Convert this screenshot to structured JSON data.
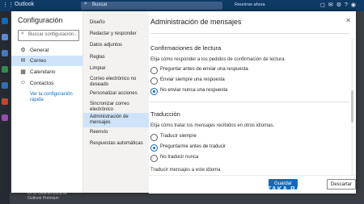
{
  "topbar": {
    "app_title": "Outlook",
    "search_placeholder": "Buscar",
    "meeting_text": "Reunirse ahora"
  },
  "background": {
    "note_line1": "en tu característica de",
    "note_line2": "Outlook Premium"
  },
  "modal": {
    "title": "Configuración",
    "search_placeholder": "Buscar configuración...",
    "nav_primary": [
      {
        "label": "General",
        "icon": "gear-icon"
      },
      {
        "label": "Correo",
        "icon": "mail-icon"
      },
      {
        "label": "Calendario",
        "icon": "calendar-icon"
      },
      {
        "label": "Contactos",
        "icon": "people-icon"
      }
    ],
    "quick_settings_link": "Ver la configuración rápida",
    "nav_secondary": [
      "Diseño",
      "Redactar y responder",
      "Datos adjuntos",
      "Reglas",
      "Limpiar",
      "Correo electrónico no deseado",
      "Personalizar acciones",
      "Sincronizar correo electrónico",
      "Administración de mensajes",
      "Reenvío",
      "Respuestas automáticas"
    ],
    "selected_secondary": "Administración de mensajes",
    "pane_title": "Administración de mensajes",
    "read_receipts": {
      "title": "Confirmaciones de lectura",
      "desc": "Elija cómo responder a los pedidos de confirmación de lectura.",
      "options": [
        "Preguntar antes de enviar una respuesta",
        "Enviar siempre una respuesta",
        "No enviar nunca una respuesta"
      ],
      "selected": 2
    },
    "translation": {
      "title": "Traducción",
      "desc": "Elija cómo tratar los mensajes recibidos en otros idiomas.",
      "options": [
        "Traducir siempre",
        "Preguntarme antes de traducir",
        "No traducir nunca"
      ],
      "selected": 1,
      "language_label": "Traducir mensajes a este idioma"
    },
    "buttons": {
      "save": "Guardar",
      "discard": "Descartar"
    }
  },
  "watermark": "XATAKA BASICS",
  "colors": {
    "accent": "#0f6cbd",
    "selected_bg": "#cfe4fa",
    "topbar": "#0f3a66"
  }
}
